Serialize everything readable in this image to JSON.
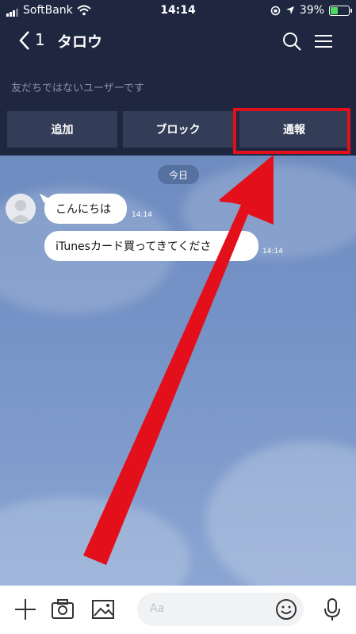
{
  "status_bar": {
    "carrier": "SoftBank",
    "time": "14:14",
    "battery": "39%",
    "battery_level": 0.39
  },
  "header": {
    "back_count": "1",
    "title": "タロウ",
    "icons": [
      "back-chevron-icon",
      "search-icon",
      "menu-icon"
    ]
  },
  "notice": {
    "text": "友だちではないユーザーです"
  },
  "actions": {
    "add": "追加",
    "block": "ブロック",
    "report": "通報"
  },
  "chat": {
    "date": "今日",
    "messages": [
      {
        "text": "こんにちは",
        "time": "14:14"
      },
      {
        "text": "iTunesカード買ってきてくださ",
        "time": "14:14"
      }
    ]
  },
  "input": {
    "placeholder": "Aa"
  },
  "toolbar_icons": [
    "plus-icon",
    "camera-icon",
    "image-icon",
    "emoji-icon",
    "microphone-icon"
  ],
  "colors": {
    "header_bg": "#1f2740",
    "button_bg": "#343d58",
    "highlight": "#e3101b",
    "arrow": "#e3101b",
    "chat_bg": "#7593c6"
  }
}
